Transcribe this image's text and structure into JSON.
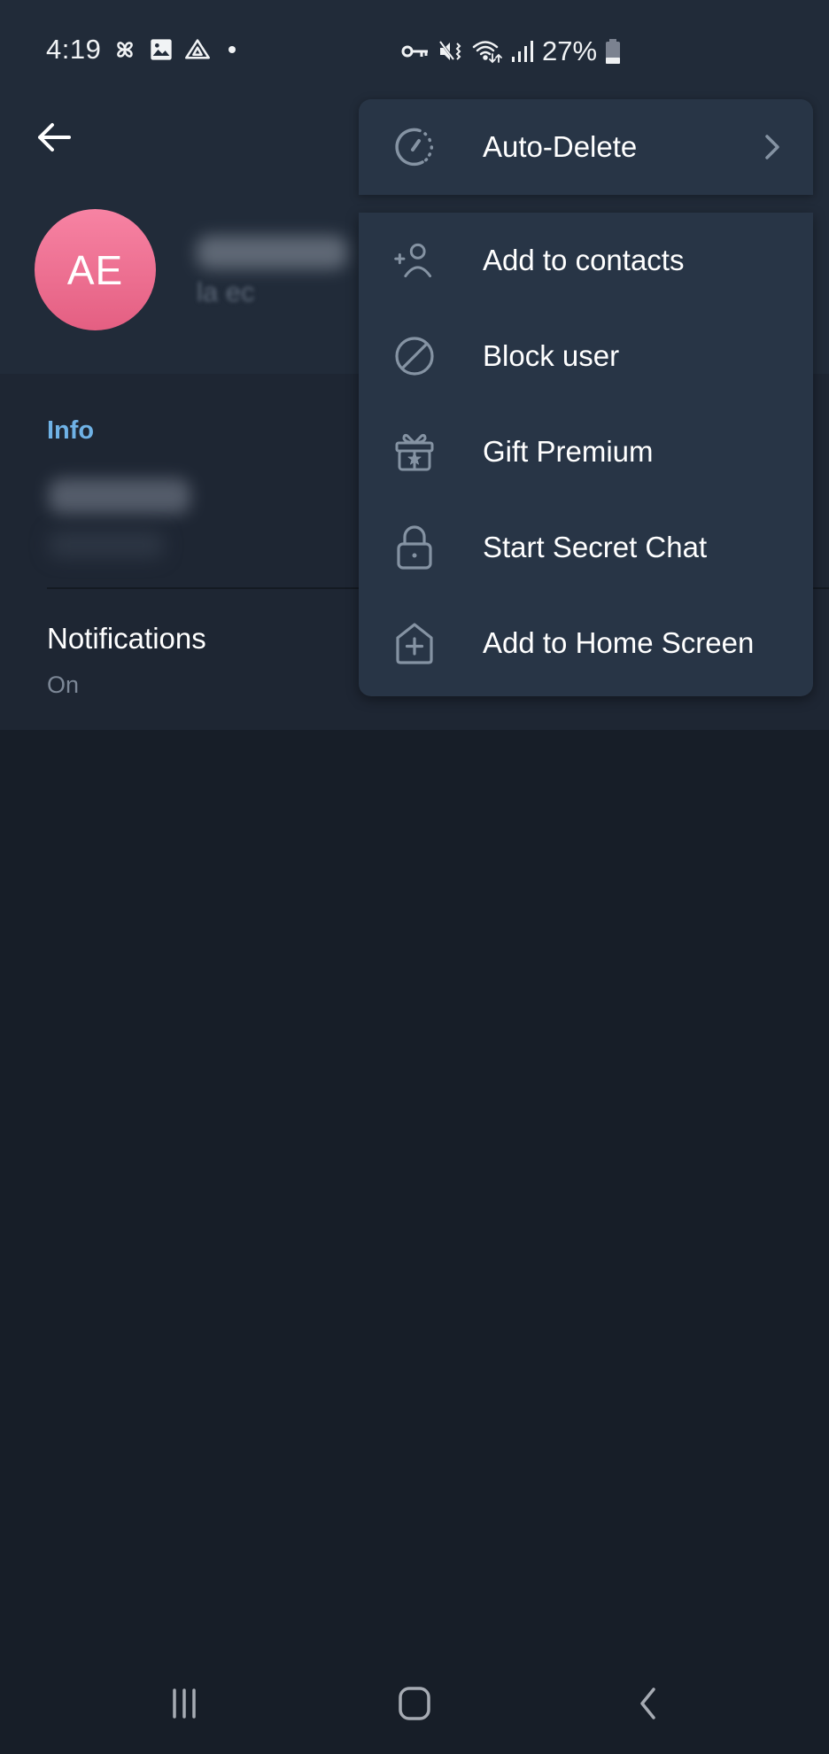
{
  "status_bar": {
    "time": "4:19",
    "left_icons": [
      "pinwheel-icon",
      "gallery-icon",
      "drive-icon",
      "dot-icon"
    ],
    "right_icons": [
      "vpn-key-icon",
      "mute-vibrate-icon",
      "wifi-icon",
      "signal-icon"
    ],
    "battery_percent": "27%",
    "battery_level": 0.27
  },
  "header": {
    "back_icon": "arrow-left-icon",
    "avatar_initials": "AE",
    "avatar_color": "#ee6e8f",
    "name": "",
    "last_seen_partial": "la          ec"
  },
  "info": {
    "section_title": "Info",
    "username": "",
    "notifications_label": "Notifications",
    "notifications_value": "On"
  },
  "menu": {
    "top_item": {
      "label": "Auto-Delete",
      "icon": "timer-icon",
      "has_submenu": true
    },
    "items": [
      {
        "label": "Add to contacts",
        "icon": "add-user-icon"
      },
      {
        "label": "Block user",
        "icon": "block-icon"
      },
      {
        "label": "Gift Premium",
        "icon": "gift-icon"
      },
      {
        "label": "Start Secret Chat",
        "icon": "lock-icon"
      },
      {
        "label": "Add to Home Screen",
        "icon": "add-home-icon"
      }
    ]
  },
  "nav_bar": {
    "recents": "recents-icon",
    "home": "home-icon",
    "back": "back-icon"
  },
  "colors": {
    "accent": "#6fb2e6",
    "header_bg": "#212b39",
    "menu_bg": "#283546",
    "page_bg": "#171e28",
    "icon_gray": "#8593a3"
  }
}
